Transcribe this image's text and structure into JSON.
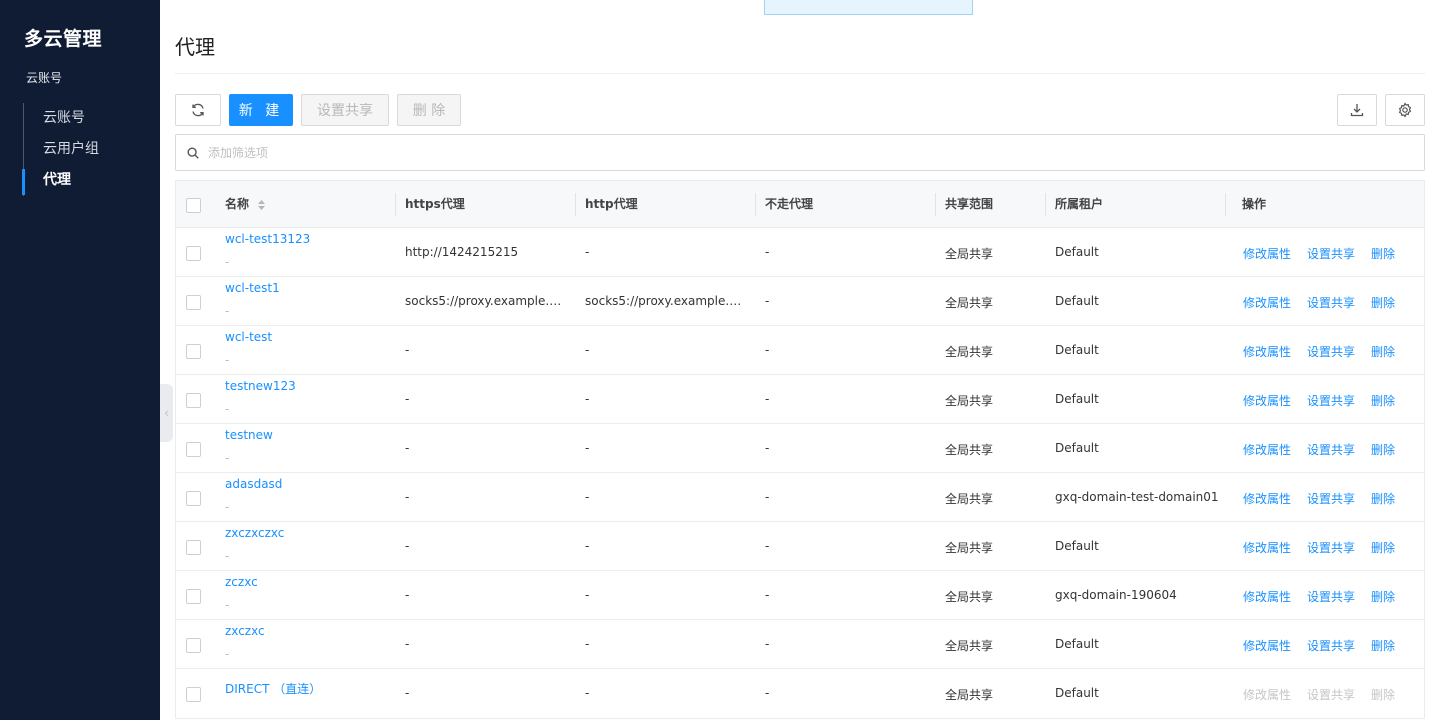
{
  "sidebar": {
    "app_title": "多云管理",
    "group_title": "云账号",
    "items": [
      {
        "label": "云账号",
        "active": false
      },
      {
        "label": "云用户组",
        "active": false
      },
      {
        "label": "代理",
        "active": true
      }
    ]
  },
  "page": {
    "title": "代理"
  },
  "toolbar": {
    "refresh_icon": "refresh-icon",
    "new_label": "新 建",
    "share_label": "设置共享",
    "delete_label": "删 除",
    "download_icon": "download-icon",
    "settings_icon": "gear-icon"
  },
  "filter": {
    "placeholder": "添加筛选项"
  },
  "table": {
    "columns": {
      "name": "名称",
      "https": "https代理",
      "http": "http代理",
      "no_proxy": "不走代理",
      "scope": "共享范围",
      "tenant": "所属租户",
      "actions": "操作"
    },
    "action_labels": {
      "edit": "修改属性",
      "share": "设置共享",
      "delete": "删除"
    },
    "rows": [
      {
        "name": "wcl-test13123",
        "sub": "-",
        "https": "http://1424215215",
        "http": "-",
        "no_proxy": "-",
        "scope": "全局共享",
        "tenant": "Default",
        "actions_enabled": true
      },
      {
        "name": "wcl-test1",
        "sub": "-",
        "https": "socks5://proxy.example.c...",
        "http": "socks5://proxy.example.c...",
        "no_proxy": "-",
        "scope": "全局共享",
        "tenant": "Default",
        "actions_enabled": true
      },
      {
        "name": "wcl-test",
        "sub": "-",
        "https": "-",
        "http": "-",
        "no_proxy": "-",
        "scope": "全局共享",
        "tenant": "Default",
        "actions_enabled": true
      },
      {
        "name": "testnew123",
        "sub": "-",
        "https": "-",
        "http": "-",
        "no_proxy": "-",
        "scope": "全局共享",
        "tenant": "Default",
        "actions_enabled": true
      },
      {
        "name": "testnew",
        "sub": "-",
        "https": "-",
        "http": "-",
        "no_proxy": "-",
        "scope": "全局共享",
        "tenant": "Default",
        "actions_enabled": true
      },
      {
        "name": "adasdasd",
        "sub": "-",
        "https": "-",
        "http": "-",
        "no_proxy": "-",
        "scope": "全局共享",
        "tenant": "gxq-domain-test-domain01",
        "actions_enabled": true
      },
      {
        "name": "zxczxczxc",
        "sub": "-",
        "https": "-",
        "http": "-",
        "no_proxy": "-",
        "scope": "全局共享",
        "tenant": "Default",
        "actions_enabled": true
      },
      {
        "name": "zczxc",
        "sub": "-",
        "https": "-",
        "http": "-",
        "no_proxy": "-",
        "scope": "全局共享",
        "tenant": "gxq-domain-190604",
        "actions_enabled": true
      },
      {
        "name": "zxczxc",
        "sub": "-",
        "https": "-",
        "http": "-",
        "no_proxy": "-",
        "scope": "全局共享",
        "tenant": "Default",
        "actions_enabled": true
      },
      {
        "name": "DIRECT （直连）",
        "sub": "",
        "https": "-",
        "http": "-",
        "no_proxy": "-",
        "scope": "全局共享",
        "tenant": "Default",
        "actions_enabled": false
      }
    ]
  },
  "colors": {
    "sidebar_bg": "#0f1c33",
    "primary": "#1890ff"
  }
}
